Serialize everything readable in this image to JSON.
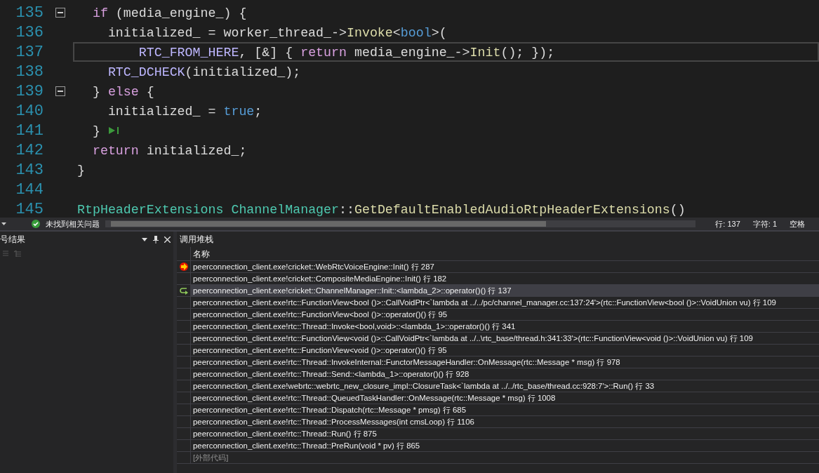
{
  "editor": {
    "lines": [
      {
        "number": "135",
        "expanded": true,
        "current": false,
        "tokens": [
          {
            "kind": "keyword",
            "text": "  if"
          },
          {
            "kind": "plain",
            "text": " (media_engine_) {"
          }
        ]
      },
      {
        "number": "136",
        "current": false,
        "tokens": [
          {
            "kind": "plain",
            "text": "    initialized_ = worker_thread_->"
          },
          {
            "kind": "function",
            "text": "Invoke"
          },
          {
            "kind": "plain",
            "text": "<"
          },
          {
            "kind": "literal",
            "text": "bool"
          },
          {
            "kind": "plain",
            "text": ">("
          }
        ]
      },
      {
        "number": "137",
        "current": true,
        "tokens": [
          {
            "kind": "macro",
            "text": "        RTC_FROM_HERE"
          },
          {
            "kind": "plain",
            "text": ", [&] { "
          },
          {
            "kind": "keyword",
            "text": "return"
          },
          {
            "kind": "plain",
            "text": " media_engine_->"
          },
          {
            "kind": "function",
            "text": "Init"
          },
          {
            "kind": "plain",
            "text": "(); });"
          }
        ]
      },
      {
        "number": "138",
        "current": false,
        "tokens": [
          {
            "kind": "macro",
            "text": "    RTC_DCHECK"
          },
          {
            "kind": "plain",
            "text": "(initialized_);"
          }
        ]
      },
      {
        "number": "139",
        "expanded": true,
        "current": false,
        "tokens": [
          {
            "kind": "plain",
            "text": "  } "
          },
          {
            "kind": "keyword",
            "text": "else"
          },
          {
            "kind": "plain",
            "text": " {"
          }
        ]
      },
      {
        "number": "140",
        "current": false,
        "tokens": [
          {
            "kind": "plain",
            "text": "    initialized_ = "
          },
          {
            "kind": "literal",
            "text": "true"
          },
          {
            "kind": "plain",
            "text": ";"
          }
        ]
      },
      {
        "number": "141",
        "current": false,
        "run_to_cursor": true,
        "tokens": [
          {
            "kind": "plain",
            "text": "  }"
          }
        ]
      },
      {
        "number": "142",
        "current": false,
        "tokens": [
          {
            "kind": "keyword",
            "text": "  return"
          },
          {
            "kind": "plain",
            "text": " initialized_;"
          }
        ]
      },
      {
        "number": "143",
        "current": false,
        "tokens": [
          {
            "kind": "plain",
            "text": "}"
          }
        ]
      },
      {
        "number": "144",
        "current": false
      },
      {
        "number": "145",
        "current": false,
        "tokens": [
          {
            "kind": "type",
            "text": "RtpHeaderExtensions "
          },
          {
            "kind": "type",
            "text": "ChannelManager"
          },
          {
            "kind": "plain",
            "text": "::"
          },
          {
            "kind": "function",
            "text": "GetDefaultEnabledAudioRtpHeaderExtensions"
          },
          {
            "kind": "plain",
            "text": "()"
          }
        ]
      }
    ]
  },
  "status_bar": {
    "issues": "未找到相关问题",
    "line": "行: 137",
    "char": "字符: 1",
    "spacing": "空格"
  },
  "left_pane": {
    "title": "号结果"
  },
  "call_stack": {
    "title": "调用堆栈",
    "column": "名称",
    "rows": [
      {
        "kind": "current",
        "selected": false,
        "external": false,
        "text": "peerconnection_client.exe!cricket::WebRtcVoiceEngine::Init() 行 287"
      },
      {
        "selected": false,
        "external": false,
        "text": "peerconnection_client.exe!cricket::CompositeMediaEngine::Init() 行 182"
      },
      {
        "kind": "return",
        "selected": true,
        "external": false,
        "text": "peerconnection_client.exe!cricket::ChannelManager::Init::<lambda_2>::operator()() 行 137"
      },
      {
        "selected": false,
        "external": false,
        "text": "peerconnection_client.exe!rtc::FunctionView<bool ()>::CallVoidPtr<`lambda at ../../pc/channel_manager.cc:137:24'>(rtc::FunctionView<bool ()>::VoidUnion vu) 行 109"
      },
      {
        "selected": false,
        "external": false,
        "text": "peerconnection_client.exe!rtc::FunctionView<bool ()>::operator()() 行 95"
      },
      {
        "selected": false,
        "external": false,
        "text": "peerconnection_client.exe!rtc::Thread::Invoke<bool,void>::<lambda_1>::operator()() 行 341"
      },
      {
        "selected": false,
        "external": false,
        "text": "peerconnection_client.exe!rtc::FunctionView<void ()>::CallVoidPtr<`lambda at ../..\\rtc_base/thread.h:341:33'>(rtc::FunctionView<void ()>::VoidUnion vu) 行 109"
      },
      {
        "selected": false,
        "external": false,
        "text": "peerconnection_client.exe!rtc::FunctionView<void ()>::operator()() 行 95"
      },
      {
        "selected": false,
        "external": false,
        "text": "peerconnection_client.exe!rtc::Thread::InvokeInternal::FunctorMessageHandler::OnMessage(rtc::Message * msg) 行 978"
      },
      {
        "selected": false,
        "external": false,
        "text": "peerconnection_client.exe!rtc::Thread::Send::<lambda_1>::operator()() 行 928"
      },
      {
        "selected": false,
        "external": false,
        "text": "peerconnection_client.exe!webrtc::webrtc_new_closure_impl::ClosureTask<`lambda at ../../rtc_base/thread.cc:928:7'>::Run() 行 33"
      },
      {
        "selected": false,
        "external": false,
        "text": "peerconnection_client.exe!rtc::Thread::QueuedTaskHandler::OnMessage(rtc::Message * msg) 行 1008"
      },
      {
        "selected": false,
        "external": false,
        "text": "peerconnection_client.exe!rtc::Thread::Dispatch(rtc::Message * pmsg) 行 685"
      },
      {
        "selected": false,
        "external": false,
        "text": "peerconnection_client.exe!rtc::Thread::ProcessMessages(int cmsLoop) 行 1106"
      },
      {
        "selected": false,
        "external": false,
        "text": "peerconnection_client.exe!rtc::Thread::Run() 行 875"
      },
      {
        "selected": false,
        "external": false,
        "text": "peerconnection_client.exe!rtc::Thread::PreRun(void * pv) 行 865"
      },
      {
        "selected": false,
        "external": true,
        "text": "[外部代码]"
      }
    ]
  }
}
